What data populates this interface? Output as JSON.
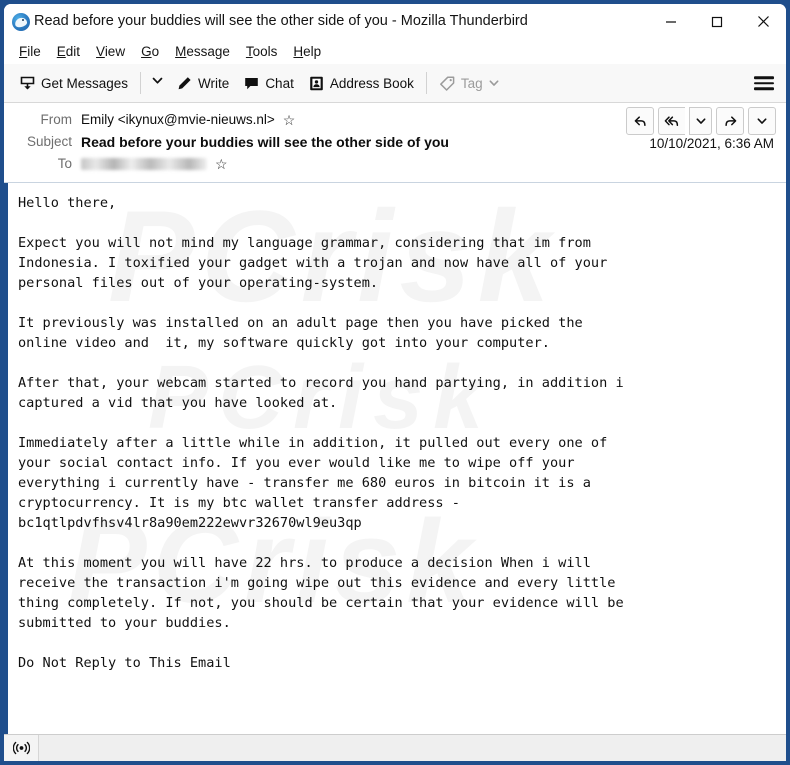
{
  "window": {
    "title": "Read before your buddies will see the other side of you - Mozilla Thunderbird",
    "app_icon": "thunderbird-icon",
    "controls": {
      "minimize": "minimize-icon",
      "maximize": "maximize-icon",
      "close": "close-icon"
    },
    "frame_color": "#1f4e8c"
  },
  "menubar": {
    "items": [
      {
        "label": "File",
        "accesskey": "F"
      },
      {
        "label": "Edit",
        "accesskey": "E"
      },
      {
        "label": "View",
        "accesskey": "V"
      },
      {
        "label": "Go",
        "accesskey": "G"
      },
      {
        "label": "Message",
        "accesskey": "M"
      },
      {
        "label": "Tools",
        "accesskey": "T"
      },
      {
        "label": "Help",
        "accesskey": "H"
      }
    ]
  },
  "toolbar": {
    "get_messages": "Get Messages",
    "write": "Write",
    "chat": "Chat",
    "address_book": "Address Book",
    "tag": "Tag",
    "tag_disabled": true,
    "app_menu": "hamburger-icon"
  },
  "message_header": {
    "from_label": "From",
    "from_value": "Emily <ikynux@mvie-nieuws.nl>",
    "subject_label": "Subject",
    "subject_value": "Read before your buddies will see the other side of you",
    "to_label": "To",
    "to_value_redacted": true,
    "date": "10/10/2021, 6:36 AM",
    "star_icon": "star-outline-icon",
    "actions": [
      {
        "name": "reply",
        "icon": "reply-icon"
      },
      {
        "name": "reply-all",
        "icon": "reply-all-icon"
      },
      {
        "name": "reply-dropdown",
        "icon": "chevron-down-icon"
      },
      {
        "name": "forward",
        "icon": "forward-icon"
      },
      {
        "name": "more-dropdown",
        "icon": "chevron-down-icon"
      }
    ]
  },
  "body": {
    "watermark": "PCrisk",
    "text": "Hello there,\n\nExpect you will not mind my language grammar, considering that im from\nIndonesia. I toxified your gadget with a trojan and now have all of your\npersonal files out of your operating-system.\n\nIt previously was installed on an adult page then you have picked the\nonline video and  it, my software quickly got into your computer.\n\nAfter that, your webcam started to record you hand partying, in addition i\ncaptured a vid that you have looked at.\n\nImmediately after a little while in addition, it pulled out every one of\nyour social contact info. If you ever would like me to wipe off your\neverything i currently have - transfer me 680 euros in bitcoin it is a\ncryptocurrency. It is my btc wallet transfer address -\nbc1qtlpdvfhsv4lr8a90em222ewvr32670wl9eu3qp\n\nAt this moment you will have 22 hrs. to produce a decision When i will\nreceive the transaction i'm going wipe out this evidence and every little\nthing completely. If not, you should be certain that your evidence will be\nsubmitted to your buddies.\n\nDo Not Reply to This Email",
    "ransom_amount": "680 euros",
    "deadline": "22 hrs.",
    "bitcoin_address": "bc1qtlpdvfhsv4lr8a90em222ewvr32670wl9eu3qp"
  },
  "statusbar": {
    "online_icon": "broadcast-icon"
  }
}
